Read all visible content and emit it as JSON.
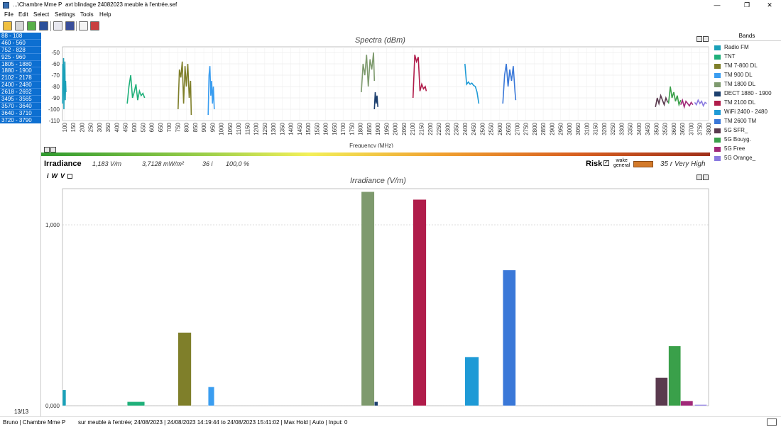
{
  "window": {
    "title_path": "...\\Chambre Mme P",
    "title_file": "avt blindage 24082023 meuble à l'entrée.sef",
    "minimize": "—",
    "maximize": "❐",
    "close": "✕"
  },
  "menu": [
    "File",
    "Edit",
    "Select",
    "Settings",
    "Tools",
    "Help"
  ],
  "toolbar_icons": [
    "open-folder-icon",
    "edit-icon",
    "refresh-icon",
    "save-icon",
    "report-icon",
    "save-as-icon",
    "list-icon",
    "table-icon"
  ],
  "band_list": [
    "88 - 108",
    "460 - 560",
    "752 - 828",
    "925 - 960",
    "1805 - 1880",
    "1880 - 1900",
    "2102 - 2178",
    "2400 - 2480",
    "2618 - 2692",
    "3495 - 3565",
    "3570 - 3640",
    "3640 - 3710",
    "3720 - 3790"
  ],
  "band_count": "13/13",
  "spectra": {
    "title": "Spectra (dBm)",
    "xlabel": "Frequency (MHz)"
  },
  "legend": {
    "header": "Bands",
    "items": [
      {
        "label": "Radio FM",
        "color": "#1aa0b8"
      },
      {
        "label": "TNT",
        "color": "#1fb07a"
      },
      {
        "label": "TM 7-800 DL",
        "color": "#7f7f2a"
      },
      {
        "label": "TM 900 DL",
        "color": "#3a9df0"
      },
      {
        "label": "TM 1800 DL",
        "color": "#7e9a6e"
      },
      {
        "label": "DECT 1880 - 1900",
        "color": "#1c3f6e"
      },
      {
        "label": "TM 2100 DL",
        "color": "#b01c4a"
      },
      {
        "label": "WiFi 2400 - 2480",
        "color": "#1e9ad6"
      },
      {
        "label": "TM 2600 TM",
        "color": "#3a78d8"
      },
      {
        "label": "5G SFR_",
        "color": "#5a3a4e"
      },
      {
        "label": "5G Bouyg.",
        "color": "#3aa04a"
      },
      {
        "label": "5G Free",
        "color": "#a02878"
      },
      {
        "label": "5G Orange_",
        "color": "#8a7ae0"
      }
    ]
  },
  "irradiance_row": {
    "label": "Irradiance",
    "vm": "1,183 V/m",
    "mw": "3,7128 mW/m²",
    "count": "36 i",
    "pct": "100,0 %",
    "risk_label": "Risk",
    "wake_line1": "wake",
    "wake_line2": "general",
    "risk_value": "35 r Very High",
    "risk_color": "#d37a2a"
  },
  "iwv": {
    "i": "i",
    "w": "W",
    "v": "V"
  },
  "chart_data": [
    {
      "type": "line",
      "title": "Spectra (dBm)",
      "xlabel": "Frequency (MHz)",
      "ylabel": "",
      "xlim": [
        88,
        3800
      ],
      "ylim": [
        -110,
        -45
      ],
      "grid": true,
      "xticks": [
        100,
        150,
        200,
        250,
        300,
        350,
        400,
        450,
        500,
        550,
        600,
        650,
        700,
        750,
        800,
        850,
        900,
        950,
        1000,
        1050,
        1100,
        1150,
        1200,
        1250,
        1300,
        1350,
        1400,
        1450,
        1500,
        1550,
        1600,
        1650,
        1700,
        1750,
        1800,
        1850,
        1900,
        1950,
        2000,
        2050,
        2100,
        2150,
        2200,
        2250,
        2300,
        2350,
        2400,
        2450,
        2500,
        2550,
        2600,
        2650,
        2700,
        2750,
        2800,
        2850,
        2900,
        2950,
        3000,
        3050,
        3100,
        3150,
        3200,
        3250,
        3300,
        3350,
        3400,
        3450,
        3500,
        3550,
        3600,
        3650,
        3700,
        3750,
        3800
      ],
      "yticks": [
        -50,
        -60,
        -70,
        -80,
        -90,
        -100,
        -110
      ],
      "series": [
        {
          "color": "#1aa0b8",
          "x": [
            88,
            90,
            92,
            94,
            96,
            98,
            100,
            102,
            104,
            106,
            108
          ],
          "y": [
            -95,
            -60,
            -70,
            -55,
            -100,
            -65,
            -80,
            -58,
            -92,
            -75,
            -85
          ]
        },
        {
          "color": "#1fb07a",
          "x": [
            460,
            470,
            480,
            490,
            500,
            510,
            520,
            530,
            540,
            550,
            560
          ],
          "y": [
            -95,
            -80,
            -70,
            -90,
            -85,
            -78,
            -92,
            -84,
            -88,
            -86,
            -90
          ]
        },
        {
          "color": "#7f7f2a",
          "x": [
            752,
            760,
            768,
            776,
            784,
            792,
            800,
            808,
            816,
            824,
            828
          ],
          "y": [
            -100,
            -65,
            -72,
            -58,
            -95,
            -62,
            -80,
            -60,
            -90,
            -75,
            -105
          ]
        },
        {
          "color": "#3a9df0",
          "x": [
            925,
            930,
            935,
            940,
            945,
            950,
            955,
            960
          ],
          "y": [
            -105,
            -70,
            -62,
            -88,
            -75,
            -95,
            -80,
            -100
          ]
        },
        {
          "color": "#7e9a6e",
          "x": [
            1805,
            1815,
            1825,
            1835,
            1845,
            1855,
            1865,
            1875,
            1880
          ],
          "y": [
            -85,
            -60,
            -70,
            -52,
            -80,
            -56,
            -65,
            -50,
            -75
          ]
        },
        {
          "color": "#1c3f6e",
          "x": [
            1880,
            1885,
            1890,
            1895,
            1900
          ],
          "y": [
            -100,
            -85,
            -95,
            -88,
            -98
          ]
        },
        {
          "color": "#b01c4a",
          "x": [
            2102,
            2112,
            2122,
            2132,
            2142,
            2152,
            2162,
            2172,
            2178
          ],
          "y": [
            -90,
            -52,
            -58,
            -54,
            -84,
            -78,
            -82,
            -80,
            -84
          ]
        },
        {
          "color": "#1e9ad6",
          "x": [
            2400,
            2410,
            2420,
            2430,
            2440,
            2450,
            2460,
            2470,
            2480
          ],
          "y": [
            -60,
            -78,
            -76,
            -78,
            -77,
            -79,
            -80,
            -85,
            -95
          ]
        },
        {
          "color": "#3a78d8",
          "x": [
            2618,
            2628,
            2638,
            2648,
            2658,
            2668,
            2678,
            2688,
            2692
          ],
          "y": [
            -95,
            -70,
            -60,
            -80,
            -65,
            -75,
            -62,
            -85,
            -92
          ]
        },
        {
          "color": "#5a3a4e",
          "x": [
            3495,
            3505,
            3515,
            3525,
            3535,
            3545,
            3555,
            3565
          ],
          "y": [
            -98,
            -90,
            -95,
            -88,
            -92,
            -96,
            -90,
            -94
          ]
        },
        {
          "color": "#3aa04a",
          "x": [
            3570,
            3580,
            3590,
            3600,
            3610,
            3620,
            3630,
            3640
          ],
          "y": [
            -95,
            -80,
            -90,
            -85,
            -93,
            -88,
            -96,
            -92
          ]
        },
        {
          "color": "#a02878",
          "x": [
            3640,
            3650,
            3660,
            3670,
            3680,
            3690,
            3700,
            3710
          ],
          "y": [
            -96,
            -92,
            -98,
            -93,
            -95,
            -97,
            -94,
            -96
          ]
        },
        {
          "color": "#8a7ae0",
          "x": [
            3720,
            3730,
            3740,
            3750,
            3760,
            3770,
            3780,
            3790
          ],
          "y": [
            -94,
            -96,
            -92,
            -95,
            -93,
            -97,
            -94,
            -95
          ]
        }
      ]
    },
    {
      "type": "bar",
      "title": "Irradiance (V/m)",
      "xlim": [
        88,
        3800
      ],
      "ylim": [
        0,
        1.2
      ],
      "yticks": [
        0,
        1
      ],
      "yticklabels": [
        "0,000",
        "1,000"
      ],
      "bars": [
        {
          "band": "Radio FM",
          "start": 88,
          "end": 108,
          "value": 0.087,
          "color": "#1aa0b8"
        },
        {
          "band": "TNT",
          "start": 460,
          "end": 560,
          "value": 0.022,
          "color": "#1fb07a"
        },
        {
          "band": "TM 7-800 DL",
          "start": 752,
          "end": 828,
          "value": 0.405,
          "color": "#7f7f2a"
        },
        {
          "band": "TM 900 DL",
          "start": 925,
          "end": 960,
          "value": 0.104,
          "color": "#3a9df0"
        },
        {
          "band": "TM 1800 DL",
          "start": 1805,
          "end": 1880,
          "value": 1.183,
          "color": "#7e9a6e"
        },
        {
          "band": "DECT 1880 - 1900",
          "start": 1880,
          "end": 1900,
          "value": 0.022,
          "color": "#1c3f6e"
        },
        {
          "band": "TM 2100 DL",
          "start": 2102,
          "end": 2178,
          "value": 1.14,
          "color": "#b01c4a"
        },
        {
          "band": "WiFi 2400 - 2480",
          "start": 2400,
          "end": 2480,
          "value": 0.27,
          "color": "#1e9ad6"
        },
        {
          "band": "TM 2600 TM",
          "start": 2618,
          "end": 2692,
          "value": 0.75,
          "color": "#3a78d8"
        },
        {
          "band": "5G SFR_",
          "start": 3495,
          "end": 3565,
          "value": 0.155,
          "color": "#5a3a4e"
        },
        {
          "band": "5G Bouyg.",
          "start": 3570,
          "end": 3640,
          "value": 0.33,
          "color": "#3aa04a"
        },
        {
          "band": "5G Free",
          "start": 3640,
          "end": 3710,
          "value": 0.027,
          "color": "#a02878"
        },
        {
          "band": "5G Orange_",
          "start": 3720,
          "end": 3790,
          "value": 0.006,
          "color": "#8a7ae0"
        }
      ]
    }
  ],
  "status": {
    "user": "Bruno | Chambre Mme P",
    "info": "sur meuble à l'entrée; 24/08/2023 | 24/08/2023 14:19:44 to 24/08/2023 15:41:02 | Max Hold | Auto | Input: 0"
  }
}
